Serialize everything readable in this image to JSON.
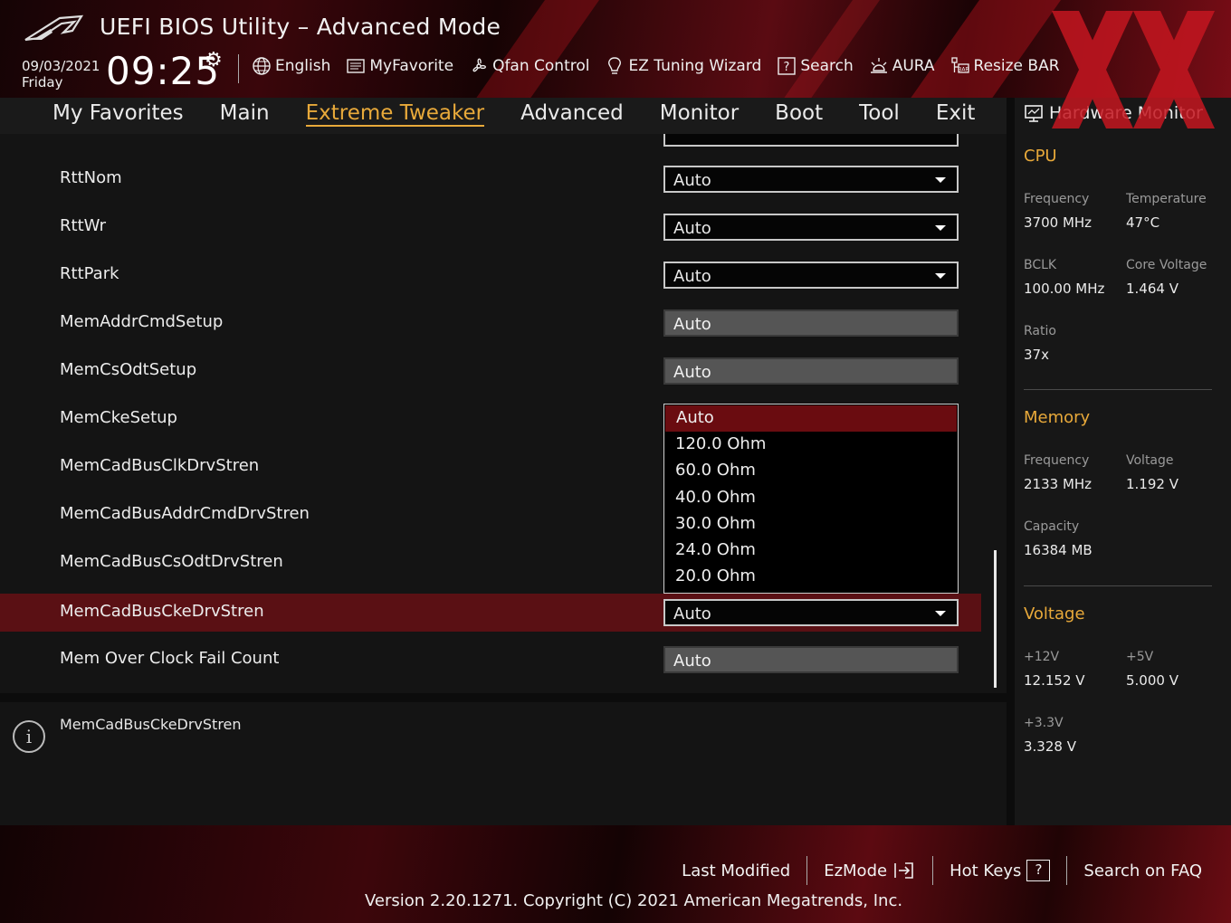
{
  "header": {
    "title": "UEFI BIOS Utility – Advanced Mode",
    "date": "09/03/2021",
    "day": "Friday",
    "time": "09:25",
    "toolbar": [
      {
        "label": "English",
        "icon": "globe-icon"
      },
      {
        "label": "MyFavorite",
        "icon": "favorite-list-icon"
      },
      {
        "label": "Qfan Control",
        "icon": "fan-icon"
      },
      {
        "label": "EZ Tuning Wizard",
        "icon": "lightbulb-icon"
      },
      {
        "label": "Search",
        "icon": "search-question-icon"
      },
      {
        "label": "AURA",
        "icon": "aura-light-icon"
      },
      {
        "label": "Resize BAR",
        "icon": "resize-bar-icon"
      }
    ]
  },
  "nav": {
    "tabs": [
      "My Favorites",
      "Main",
      "Extreme Tweaker",
      "Advanced",
      "Monitor",
      "Boot",
      "Tool",
      "Exit"
    ],
    "active": "Extreme Tweaker"
  },
  "settings": [
    {
      "label": "RttNom",
      "value": "Auto",
      "type": "dropdown"
    },
    {
      "label": "RttWr",
      "value": "Auto",
      "type": "dropdown"
    },
    {
      "label": "RttPark",
      "value": "Auto",
      "type": "dropdown"
    },
    {
      "label": "MemAddrCmdSetup",
      "value": "Auto",
      "type": "readonly"
    },
    {
      "label": "MemCsOdtSetup",
      "value": "Auto",
      "type": "readonly"
    },
    {
      "label": "MemCkeSetup",
      "value": "",
      "type": "none"
    },
    {
      "label": "MemCadBusClkDrvStren",
      "value": "",
      "type": "none"
    },
    {
      "label": "MemCadBusAddrCmdDrvStren",
      "value": "",
      "type": "none"
    },
    {
      "label": "MemCadBusCsOdtDrvStren",
      "value": "",
      "type": "none"
    },
    {
      "label": "MemCadBusCkeDrvStren",
      "value": "Auto",
      "type": "dropdown",
      "selected": true
    },
    {
      "label": "Mem Over Clock Fail Count",
      "value": "Auto",
      "type": "readonly"
    }
  ],
  "dropdown_options": [
    "Auto",
    "120.0 Ohm",
    "60.0 Ohm",
    "40.0 Ohm",
    "30.0 Ohm",
    "24.0 Ohm",
    "20.0 Ohm"
  ],
  "dropdown_highlighted": "Auto",
  "help": {
    "text": "MemCadBusCkeDrvStren"
  },
  "hardware_monitor": {
    "title": "Hardware Monitor",
    "cpu": {
      "title": "CPU",
      "frequency_label": "Frequency",
      "frequency": "3700 MHz",
      "temperature_label": "Temperature",
      "temperature": "47°C",
      "bclk_label": "BCLK",
      "bclk": "100.00 MHz",
      "core_voltage_label": "Core Voltage",
      "core_voltage": "1.464 V",
      "ratio_label": "Ratio",
      "ratio": "37x"
    },
    "memory": {
      "title": "Memory",
      "frequency_label": "Frequency",
      "frequency": "2133 MHz",
      "voltage_label": "Voltage",
      "voltage": "1.192 V",
      "capacity_label": "Capacity",
      "capacity": "16384 MB"
    },
    "voltage": {
      "title": "Voltage",
      "v12_label": "+12V",
      "v12": "12.152 V",
      "v5_label": "+5V",
      "v5": "5.000 V",
      "v33_label": "+3.3V",
      "v33": "3.328 V"
    }
  },
  "footer": {
    "last_modified": "Last Modified",
    "ezmode": "EzMode",
    "hotkeys": "Hot Keys",
    "hotkeys_key": "?",
    "search_faq": "Search on FAQ",
    "copyright": "Version 2.20.1271. Copyright (C) 2021 American Megatrends, Inc."
  },
  "colors": {
    "accent": "#e8a93a",
    "selected_row": "#5a1014",
    "dropdown_highlight": "#6a0c10"
  }
}
